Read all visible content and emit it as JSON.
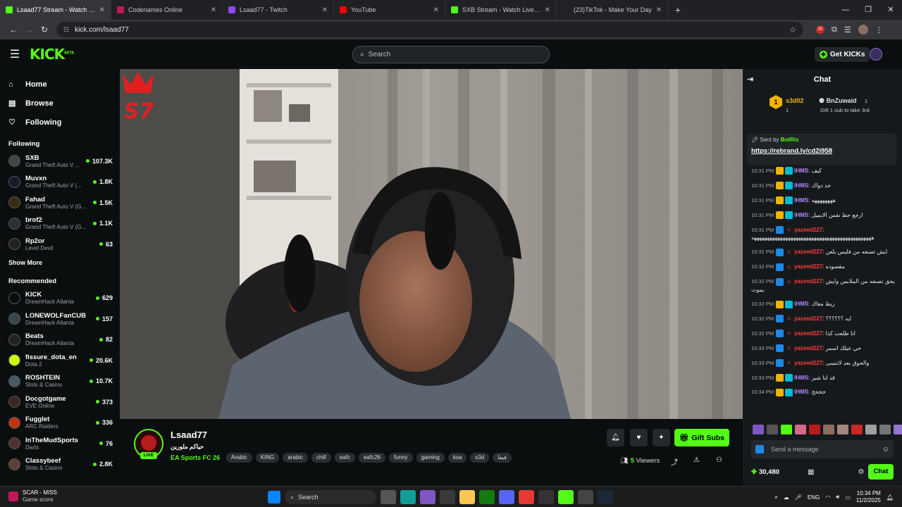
{
  "browser": {
    "tabs": [
      {
        "label": "Lsaad77 Stream - Watch Live o",
        "color": "#53fc18",
        "active": true
      },
      {
        "label": "Codenames Online",
        "color": "#c2185b",
        "active": false
      },
      {
        "label": "Lsaad77 - Twitch",
        "color": "#9146ff",
        "active": false
      },
      {
        "label": "YouTube",
        "color": "#ff0000",
        "active": false
      },
      {
        "label": "SXB Stream - Watch Live on Kic",
        "color": "#53fc18",
        "active": false
      },
      {
        "label": "(23)TikTok - Make Your Day",
        "color": "#222222",
        "active": false
      }
    ],
    "url": "kick.com/lsaad77",
    "ext_badge": "20"
  },
  "header": {
    "logo": "KICK",
    "logo_sup": "BETA",
    "search_placeholder": "Search",
    "get_kicks": "Get KICKs"
  },
  "sidebar": {
    "nav": [
      {
        "label": "Home",
        "icon": "home-icon",
        "glyph": "⌂"
      },
      {
        "label": "Browse",
        "icon": "browse-icon",
        "glyph": "▤"
      },
      {
        "label": "Following",
        "icon": "heart-icon",
        "glyph": "♡"
      }
    ],
    "following_title": "Following",
    "following": [
      {
        "name": "SXB",
        "game": "Grand Theft Auto V ...",
        "viewers": "107.3K",
        "color": "#444"
      },
      {
        "name": "Muvxn",
        "game": "Grand Theft Auto V (...",
        "viewers": "1.8K",
        "color": "#1a1a2e"
      },
      {
        "name": "Fahad",
        "game": "Grand Theft Auto V (G...",
        "viewers": "1.5K",
        "color": "#3a2a10"
      },
      {
        "name": "brof2",
        "game": "Grand Theft Auto V (G...",
        "viewers": "1.1K",
        "color": "#263238"
      },
      {
        "name": "Rp2or",
        "game": "Level Devil",
        "viewers": "63",
        "color": "#212121"
      }
    ],
    "show_more": "Show More",
    "recommended_title": "Recommended",
    "recommended": [
      {
        "name": "KICK",
        "game": "DreamHack Atlanta",
        "viewers": "629",
        "color": "#0b0e0f"
      },
      {
        "name": "LONEWOLFanCUB",
        "game": "DreamHack Atlanta",
        "viewers": "157",
        "color": "#37474f"
      },
      {
        "name": "Beats",
        "game": "DreamHack Atlanta",
        "viewers": "82",
        "color": "#222"
      },
      {
        "name": "fissure_dota_en",
        "game": "Dota 2",
        "viewers": "20.6K",
        "color": "#c6ff00"
      },
      {
        "name": "ROSHTEIN",
        "game": "Slots & Casino",
        "viewers": "10.7K",
        "color": "#455a64"
      },
      {
        "name": "Docgotgame",
        "game": "EVE Online",
        "viewers": "373",
        "color": "#3e2723"
      },
      {
        "name": "Fugglet",
        "game": "ARC Raiders",
        "viewers": "336",
        "color": "#bf360c"
      },
      {
        "name": "InTheMudSports",
        "game": "Darts",
        "viewers": "76",
        "color": "#4e342e"
      },
      {
        "name": "Classybeef",
        "game": "Slots & Casino",
        "viewers": "2.8K",
        "color": "#5d4037"
      }
    ]
  },
  "video": {
    "overlay_logo_text": "S7"
  },
  "stream": {
    "name": "Lsaad77",
    "title": "حياكم ملورين",
    "category": "EA Sports FC 26",
    "live": "LIVE",
    "tags": [
      "Arabic",
      "KING",
      "arabic",
      "chill",
      "eafc",
      "eafc26",
      "funny",
      "gaming",
      "ksa",
      "s3d",
      "فيفا"
    ],
    "gift_subs": "Gift Subs",
    "viewers_count": "5",
    "viewers_label": "Viewers"
  },
  "chat": {
    "title": "Chat",
    "leaderboard": {
      "first_name": "s3d02",
      "first_count": "1",
      "second_name": "BnZuwaid",
      "second_count": "1",
      "third_hint": "Gift 1 sub to take 3rd",
      "rank": "1"
    },
    "pinned": {
      "sent_by_label": "Sent by",
      "sender": "BotRix",
      "link": "https://rebrand.ly/cd2i958"
    },
    "messages": [
      {
        "time": "10:31 PM",
        "user": "IHMS",
        "text": "كيف",
        "type": 1
      },
      {
        "time": "10:31 PM",
        "user": "IHMS",
        "text": "خذ دواك",
        "type": 1
      },
      {
        "time": "10:31 PM",
        "user": "IHMS",
        "text": "ههههههههه",
        "type": 1
      },
      {
        "time": "10:31 PM",
        "user": "IHMS",
        "text": "ارجع حط نفس الايميل",
        "type": 1
      },
      {
        "time": "10:31 PM",
        "user": "yazeed227",
        "text": "ههههههههههههههههههههههههههههههههههههههههههههههه",
        "type": 2
      },
      {
        "time": "10:31 PM",
        "user": "yazeed227",
        "text": "ايش تصنعه من فليس يلعن",
        "type": 2
      },
      {
        "time": "10:32 PM",
        "user": "yazeed227",
        "text": "مقصوده",
        "type": 2
      },
      {
        "time": "10:32 PM",
        "user": "yazeed227",
        "text": "يحق تصنعه من الملابس وايش يموت",
        "type": 2
      },
      {
        "time": "10:32 PM",
        "user": "IHMS",
        "text": "زيط معاك",
        "type": 1
      },
      {
        "time": "10:32 PM",
        "user": "yazeed227",
        "text": "ايه ؟؟؟؟؟؟",
        "type": 2
      },
      {
        "time": "10:32 PM",
        "user": "yazeed227",
        "text": "انا طلعت كذا",
        "type": 2
      },
      {
        "time": "10:33 PM",
        "user": "yazeed227",
        "text": "حي عيلك اسمر",
        "type": 2
      },
      {
        "time": "10:33 PM",
        "user": "yazeed227",
        "text": "والحوق بعد لاتنسى",
        "type": 2
      },
      {
        "time": "10:33 PM",
        "user": "IHMS",
        "text": "قد لنا شير",
        "type": 1
      },
      {
        "time": "10:34 PM",
        "user": "IHMS",
        "text": "خخخخ",
        "type": 1
      }
    ],
    "input_placeholder": "Send a message",
    "kicks_balance": "30,480",
    "chat_button": "Chat"
  },
  "taskbar": {
    "weather_title": "SCAR - MISS",
    "weather_sub": "Game score",
    "search": "Search",
    "lang": "ENG",
    "time": "10:34 PM",
    "date": "11/2/2025"
  }
}
